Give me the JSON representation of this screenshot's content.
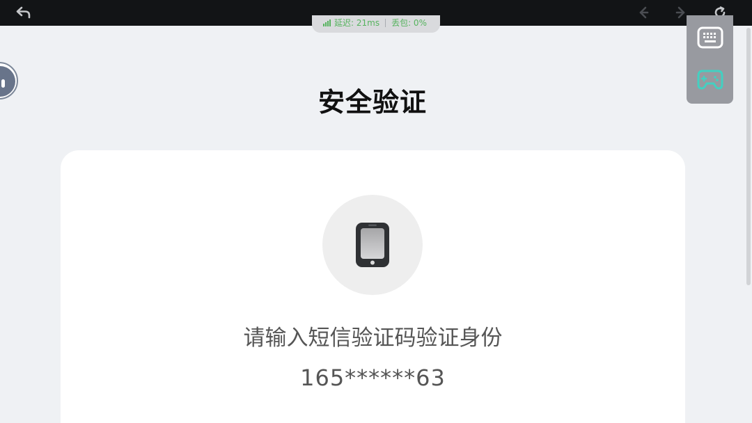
{
  "network": {
    "latency": "延迟: 21ms",
    "packet_loss": "丢包: 0%"
  },
  "page": {
    "title": "安全验证",
    "prompt": "请输入短信验证码验证身份",
    "masked_phone": "165******63"
  },
  "icons": {
    "back": "back-arrow-icon",
    "prev": "prev-arrow-icon",
    "next": "next-arrow-icon",
    "refresh": "refresh-icon",
    "keyboard": "keyboard-icon",
    "gamepad": "gamepad-icon",
    "phone": "phone-icon",
    "signal": "signal-bars-icon",
    "assistant": "assistant-avatar-icon"
  },
  "colors": {
    "topbar": "#121416",
    "network_text": "#56b35e",
    "gamepad_accent": "#43d0c1",
    "background": "#eff1f4",
    "card": "#ffffff"
  }
}
